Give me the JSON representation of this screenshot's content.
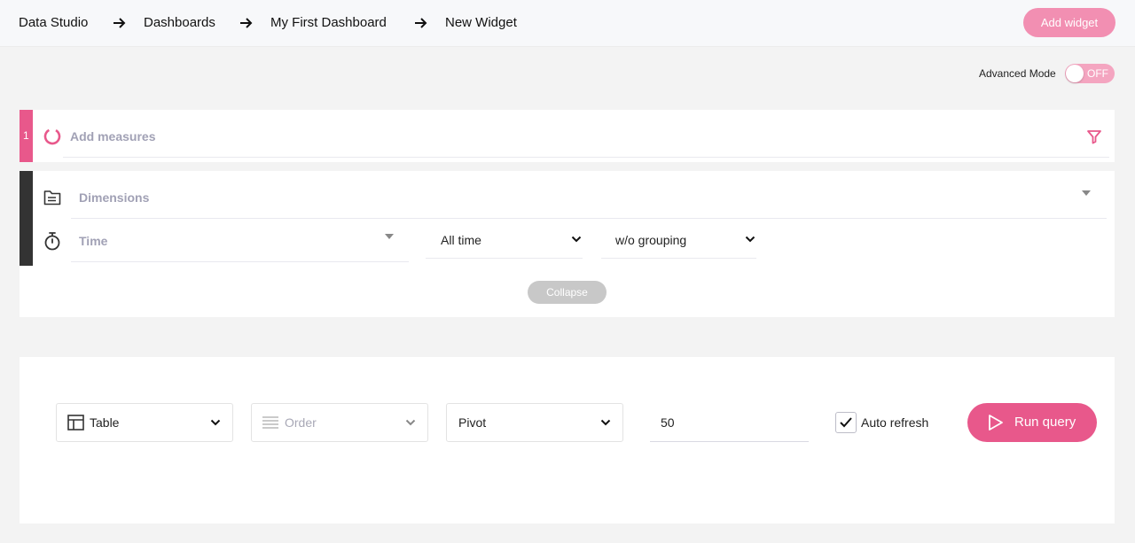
{
  "breadcrumbs": [
    "Data Studio",
    "Dashboards",
    "My First Dashboard",
    "New Widget"
  ],
  "header": {
    "add_widget_label": "Add widget"
  },
  "advanced_mode": {
    "label": "Advanced Mode",
    "state": "OFF"
  },
  "measures": {
    "step": "1",
    "placeholder": "Add measures"
  },
  "dimensions": {
    "placeholder": "Dimensions"
  },
  "time": {
    "placeholder": "Time",
    "range": "All time",
    "grouping": "w/o grouping"
  },
  "collapse_label": "Collapse",
  "query": {
    "chart_type": "Table",
    "order": "Order",
    "pivot": "Pivot",
    "limit": "50",
    "auto_refresh_label": "Auto refresh",
    "auto_refresh_checked": true,
    "run_label": "Run query"
  },
  "colors": {
    "accent": "#e8588b",
    "accent_light": "#f28fb2",
    "dark": "#333333"
  },
  "icons": [
    "arrow-right-icon",
    "loading-ring-icon",
    "filter-icon",
    "folder-icon",
    "stopwatch-icon",
    "table-icon",
    "order-lines-icon",
    "chevron-down-icon",
    "check-icon",
    "play-icon"
  ]
}
